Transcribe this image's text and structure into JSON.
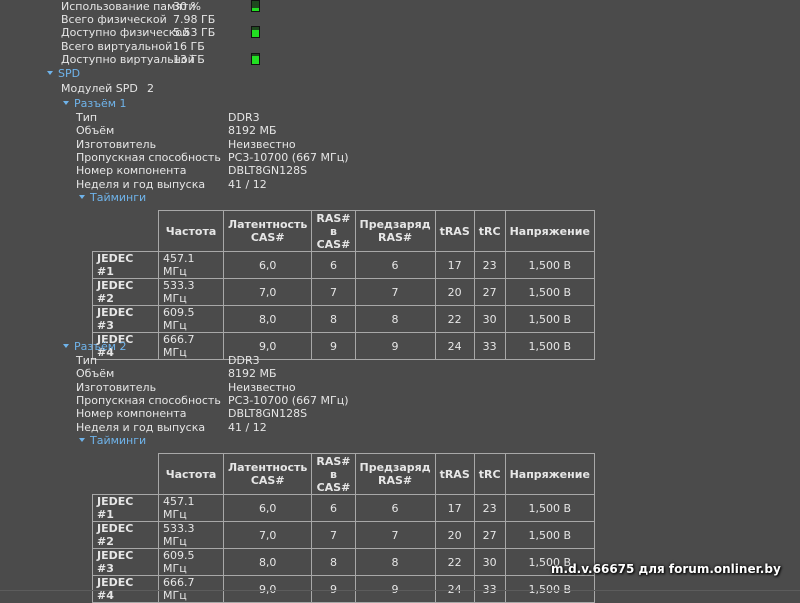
{
  "memory": [
    {
      "label": "Использование памяти",
      "value": "30 %",
      "bar_fill_percent": 30
    },
    {
      "label": "Всего физической",
      "value": "7.98 ГБ"
    },
    {
      "label": "Доступно физической",
      "value": "5.53 ГБ",
      "bar_fill_percent": 69
    },
    {
      "label": "Всего виртуальной",
      "value": "16 ГБ"
    },
    {
      "label": "Доступно виртуальной",
      "value": "13 ГБ",
      "bar_fill_percent": 81
    }
  ],
  "spd": {
    "title": "SPD",
    "modules_label": "Модулей SPD",
    "modules_value": "2",
    "slots": [
      {
        "title": "Разъём 1",
        "props": [
          [
            "Тип",
            "DDR3"
          ],
          [
            "Объём",
            "8192 МБ"
          ],
          [
            "Изготовитель",
            "Неизвестно"
          ],
          [
            "Пропускная способность",
            "PC3-10700 (667 МГц)"
          ],
          [
            "Номер компонента",
            "DBLT8GN128S"
          ],
          [
            "Неделя и год выпуска",
            "41 / 12"
          ]
        ],
        "timings_title": "Тайминги"
      },
      {
        "title": "Разъём 2",
        "props": [
          [
            "Тип",
            "DDR3"
          ],
          [
            "Объём",
            "8192 МБ"
          ],
          [
            "Изготовитель",
            "Неизвестно"
          ],
          [
            "Пропускная способность",
            "PC3-10700 (667 МГц)"
          ],
          [
            "Номер компонента",
            "DBLT8GN128S"
          ],
          [
            "Неделя и год выпуска",
            "41 / 12"
          ]
        ],
        "timings_title": "Тайминги"
      }
    ],
    "timing_headers": [
      "Частота",
      "Латентность CAS#",
      "RAS# в CAS#",
      "Предзаряд RAS#",
      "tRAS",
      "tRC",
      "Напряжение"
    ],
    "timing_rows": [
      [
        "JEDEC #1",
        "457.1 МГц",
        "6,0",
        "6",
        "6",
        "17",
        "23",
        "1,500 В"
      ],
      [
        "JEDEC #2",
        "533.3 МГц",
        "7,0",
        "7",
        "7",
        "20",
        "27",
        "1,500 В"
      ],
      [
        "JEDEC #3",
        "609.5 МГц",
        "8,0",
        "8",
        "8",
        "22",
        "30",
        "1,500 В"
      ],
      [
        "JEDEC #4",
        "666.7 МГц",
        "9,0",
        "9",
        "9",
        "24",
        "33",
        "1,500 В"
      ]
    ]
  },
  "watermark": "m.d.v.66675 для forum.onliner.by"
}
